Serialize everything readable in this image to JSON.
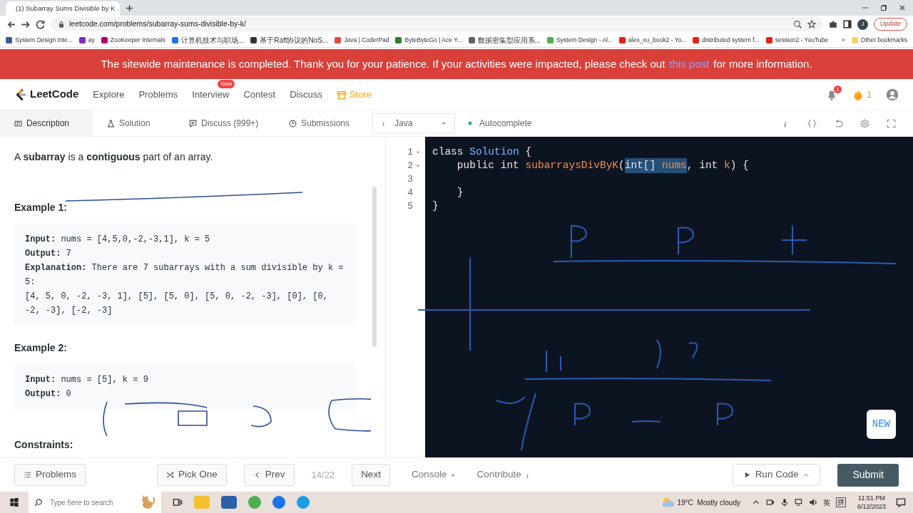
{
  "browser": {
    "tab_title": "(1) Subarray Sums Divisible by K",
    "url": "leetcode.com/problems/subarray-sums-divisible-by-k/",
    "profile": "J",
    "update_button": "Update",
    "bookmarks": [
      {
        "label": "System Design Inte...",
        "color": "#3b5998"
      },
      {
        "label": "ay",
        "color": "#7b2fbe"
      },
      {
        "label": "ZooKeeper Internals",
        "color": "#b0006d"
      },
      {
        "label": "计算机技术与职场...",
        "color": "#1a73e8"
      },
      {
        "label": "基于Raft协议的NoS...",
        "color": "#333333"
      },
      {
        "label": "Java | CoderPad",
        "color": "#e04a3f"
      },
      {
        "label": "ByteByteGo | Ace Y...",
        "color": "#2e7d32"
      },
      {
        "label": "数据密集型应用系...",
        "color": "#5f6368"
      },
      {
        "label": "System Design - Al...",
        "color": "#4caf50"
      },
      {
        "label": "alex_xu_book2 - Yo...",
        "color": "#e62117"
      },
      {
        "label": "distributed system f...",
        "color": "#e62117"
      },
      {
        "label": "session2 - YouTube",
        "color": "#e62117"
      }
    ],
    "more": "»",
    "other_bookmarks": "Other bookmarks"
  },
  "banner": {
    "text": "The sitewide maintenance is completed. Thank you for your patience. If your activities were impacted, please check out",
    "link": "this post",
    "text_after": "for more information."
  },
  "nav": {
    "logo": "LeetCode",
    "items": [
      {
        "label": "Explore"
      },
      {
        "label": "Problems"
      },
      {
        "label": "Interview",
        "badge": "New"
      },
      {
        "label": "Contest"
      },
      {
        "label": "Discuss"
      }
    ],
    "store": "Store",
    "notifications": "1",
    "streak": "1"
  },
  "toolbar": {
    "tabs": [
      {
        "label": "Description",
        "selected": true
      },
      {
        "label": "Solution",
        "selected": false
      },
      {
        "label": "Discuss (999+)",
        "selected": false
      },
      {
        "label": "Submissions",
        "selected": false
      }
    ],
    "language": "Java",
    "autocomplete": "Autocomplete"
  },
  "description": {
    "paragraph": "A **subarray** is a **contiguous** part of an array.",
    "examples": [
      {
        "title": "Example 1:",
        "lines": [
          "**Input:** nums = [4,5,0,-2,-3,1], k = 5",
          "**Output:** 7",
          "**Explanation:** There are 7 subarrays with a sum divisible by k = 5:",
          "[4, 5, 0, -2, -3, 1], [5], [5, 0], [5, 0, -2, -3], [0], [0, -2, -3], [-2, -3]"
        ]
      },
      {
        "title": "Example 2:",
        "lines": [
          "**Input:** nums = [5], k = 9",
          "**Output:** 0"
        ]
      }
    ],
    "constraints": "Constraints:"
  },
  "editor": {
    "lines": [
      {
        "number": "1",
        "foldable": true,
        "tokens": [
          {
            "text": "class ",
            "kind": "keyword",
            "selected": false
          },
          {
            "text": "Solution",
            "kind": "type",
            "selected": false
          },
          {
            "text": " {",
            "kind": "plain",
            "selected": false
          }
        ]
      },
      {
        "number": "2",
        "foldable": true,
        "tokens": [
          {
            "text": "    public int ",
            "kind": "keyword",
            "selected": false
          },
          {
            "text": "subarraysDivByK",
            "kind": "name",
            "selected": false
          },
          {
            "text": "(",
            "kind": "plain",
            "selected": false
          },
          {
            "text": "int[] ",
            "kind": "keyword",
            "selected": true
          },
          {
            "text": "nums",
            "kind": "name",
            "selected": true
          },
          {
            "text": ", int ",
            "kind": "keyword",
            "selected": false
          },
          {
            "text": "k",
            "kind": "name",
            "selected": false
          },
          {
            "text": ") {",
            "kind": "plain",
            "selected": false
          }
        ]
      },
      {
        "number": "3",
        "foldable": false
      },
      {
        "number": "4",
        "foldable": false,
        "tokens": [
          {
            "text": "    }",
            "kind": "plain",
            "selected": false
          }
        ]
      },
      {
        "number": "5",
        "foldable": false,
        "tokens": [
          {
            "text": "}",
            "kind": "plain",
            "selected": false
          }
        ]
      }
    ],
    "new_button": "NEW"
  },
  "footer": {
    "problems": "Problems",
    "pick_one": "Pick One",
    "prev": "Prev",
    "progress": "14/22",
    "next": "Next",
    "console": "Console",
    "contribute": "Contribute",
    "run_code": "Run Code",
    "submit": "Submit"
  },
  "taskbar": {
    "search_placeholder": "Type here to search",
    "weather": "19°C  Mostly cloudy",
    "ime": "英",
    "ime_mode": "拼",
    "time": "11:51 PM",
    "date": "6/12/2023"
  }
}
